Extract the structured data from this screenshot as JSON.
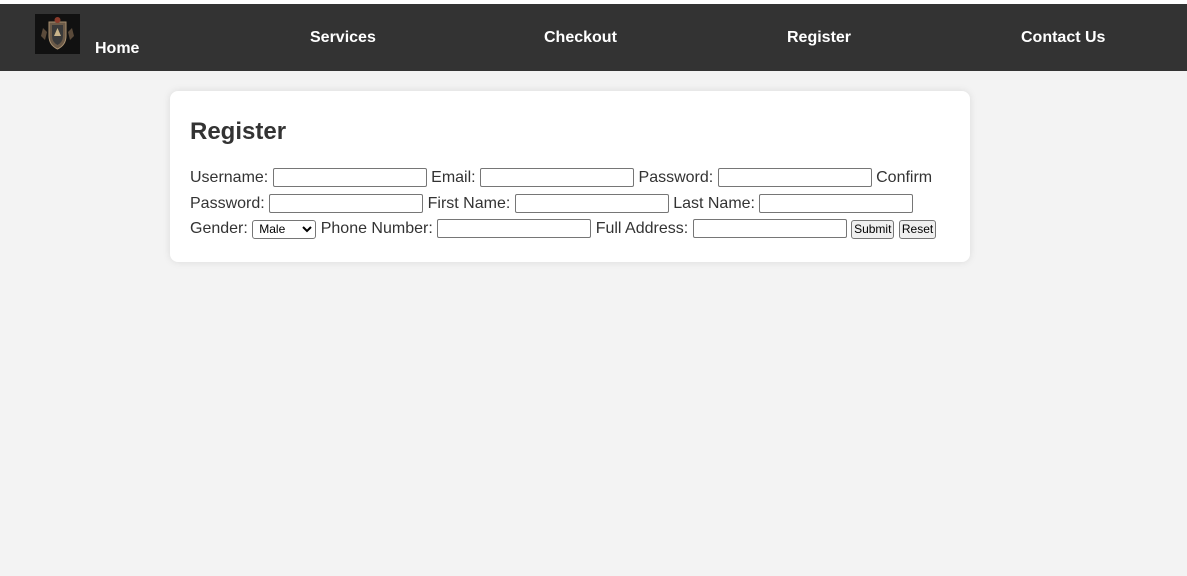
{
  "nav": {
    "home": "Home",
    "services": "Services",
    "checkout": "Checkout",
    "register": "Register",
    "contact": "Contact Us"
  },
  "form": {
    "title": "Register",
    "username_label": "Username:",
    "email_label": "Email:",
    "password_label": "Password:",
    "confirm_password_label": "Confirm Password:",
    "first_name_label": "First Name:",
    "last_name_label": "Last Name:",
    "gender_label": "Gender:",
    "gender_selected": "Male",
    "phone_label": "Phone Number:",
    "address_label": "Full Address:",
    "submit_label": "Submit",
    "reset_label": "Reset"
  },
  "colors": {
    "navbar": "#333333",
    "background": "#f3f3f3",
    "card": "#ffffff"
  }
}
